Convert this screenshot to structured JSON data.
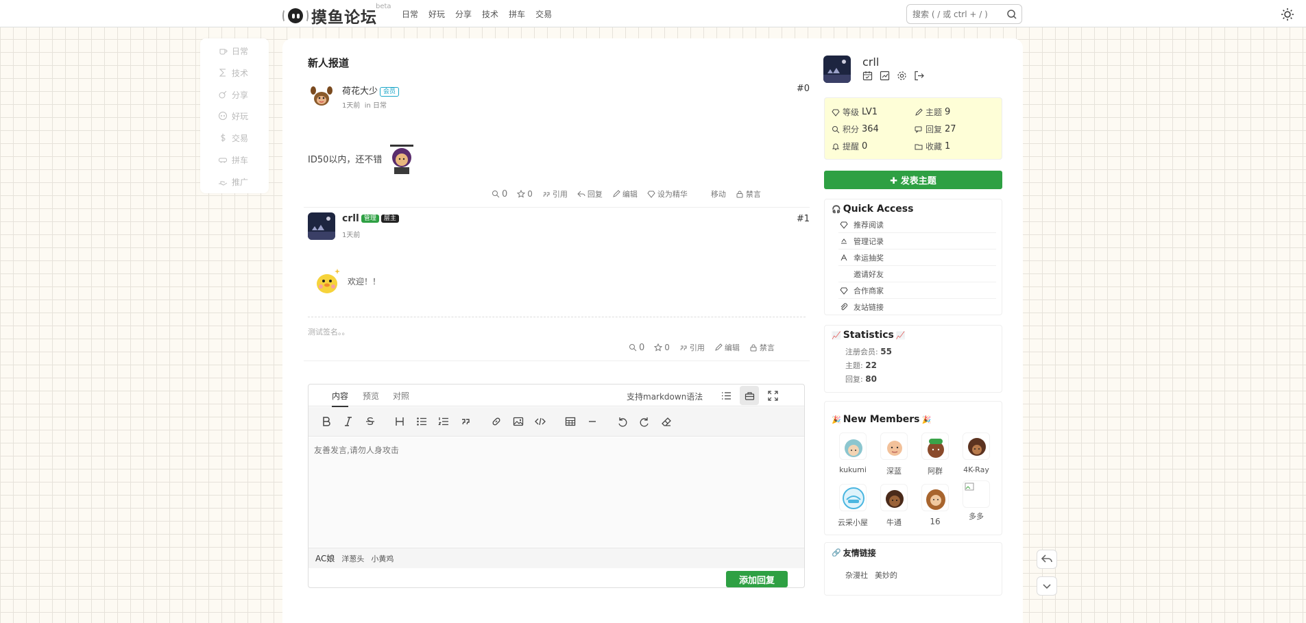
{
  "header": {
    "site_title": "摸鱼论坛",
    "beta": "beta",
    "nav": [
      "日常",
      "好玩",
      "分享",
      "技术",
      "拼车",
      "交易"
    ],
    "search_placeholder": "搜索 ( / 或 ctrl + / )"
  },
  "categories": [
    "日常",
    "技术",
    "分享",
    "好玩",
    "交易",
    "拼车",
    "推广"
  ],
  "thread": {
    "title": "新人报道",
    "posts": [
      {
        "author": "荷花大少",
        "badges": [
          {
            "text": "会员",
            "color": "#1aa6c8"
          }
        ],
        "time": "1天前",
        "category_prefix": "in",
        "category": "日常",
        "floor": "#0",
        "content": "ID50以内，还不错",
        "views": "0",
        "stars": "0",
        "actions": [
          "引用",
          "回复",
          "编辑",
          "设为精华",
          "移动",
          "禁言"
        ]
      },
      {
        "author": "crll",
        "badges": [
          {
            "text": "管理",
            "color": "#2ea043"
          },
          {
            "text": "层主",
            "color": "#222222"
          }
        ],
        "time": "1天前",
        "floor": "#1",
        "content": "欢迎！！",
        "signature": "测试签名。。",
        "views": "0",
        "stars": "0",
        "actions": [
          "引用",
          "编辑",
          "禁言"
        ]
      }
    ]
  },
  "editor": {
    "tabs": [
      "内容",
      "预览",
      "对照"
    ],
    "markdown_hint": "支持markdown语法",
    "placeholder": "友善发言,请勿人身攻击",
    "emoji_sets": [
      "AC娘",
      "洋葱头",
      "小黄鸡"
    ],
    "submit_label": "添加回复"
  },
  "sidebar": {
    "username": "crll",
    "stats": {
      "level_label": "等级",
      "level": "LV1",
      "topics_label": "主题",
      "topics": "9",
      "points_label": "积分",
      "points": "364",
      "replies_label": "回复",
      "replies": "27",
      "notify_label": "提醒",
      "notify": "0",
      "fav_label": "收藏",
      "fav": "1"
    },
    "new_topic_label": "发表主题",
    "quick_access": {
      "title": "Quick Access",
      "items": [
        "推荐阅读",
        "管理记录",
        "幸运抽奖",
        "邀请好友",
        "合作商家",
        "友站链接"
      ]
    },
    "statistics": {
      "title": "Statistics",
      "members_label": "注册会员:",
      "members": "55",
      "topics_label": "主题:",
      "topics": "22",
      "replies_label": "回复:",
      "replies": "80"
    },
    "new_members": {
      "title": "New Members",
      "members": [
        "kukumi",
        "深蓝",
        "阿群",
        "4K-Ray",
        "云采小屋",
        "牛通",
        "16",
        "多多"
      ]
    },
    "friend_links": {
      "title": "友情链接",
      "items": [
        "杂漫社",
        "美妙的"
      ]
    }
  },
  "colors": {
    "accent_green": "#2ea043",
    "stats_bg": "#fefed7"
  }
}
